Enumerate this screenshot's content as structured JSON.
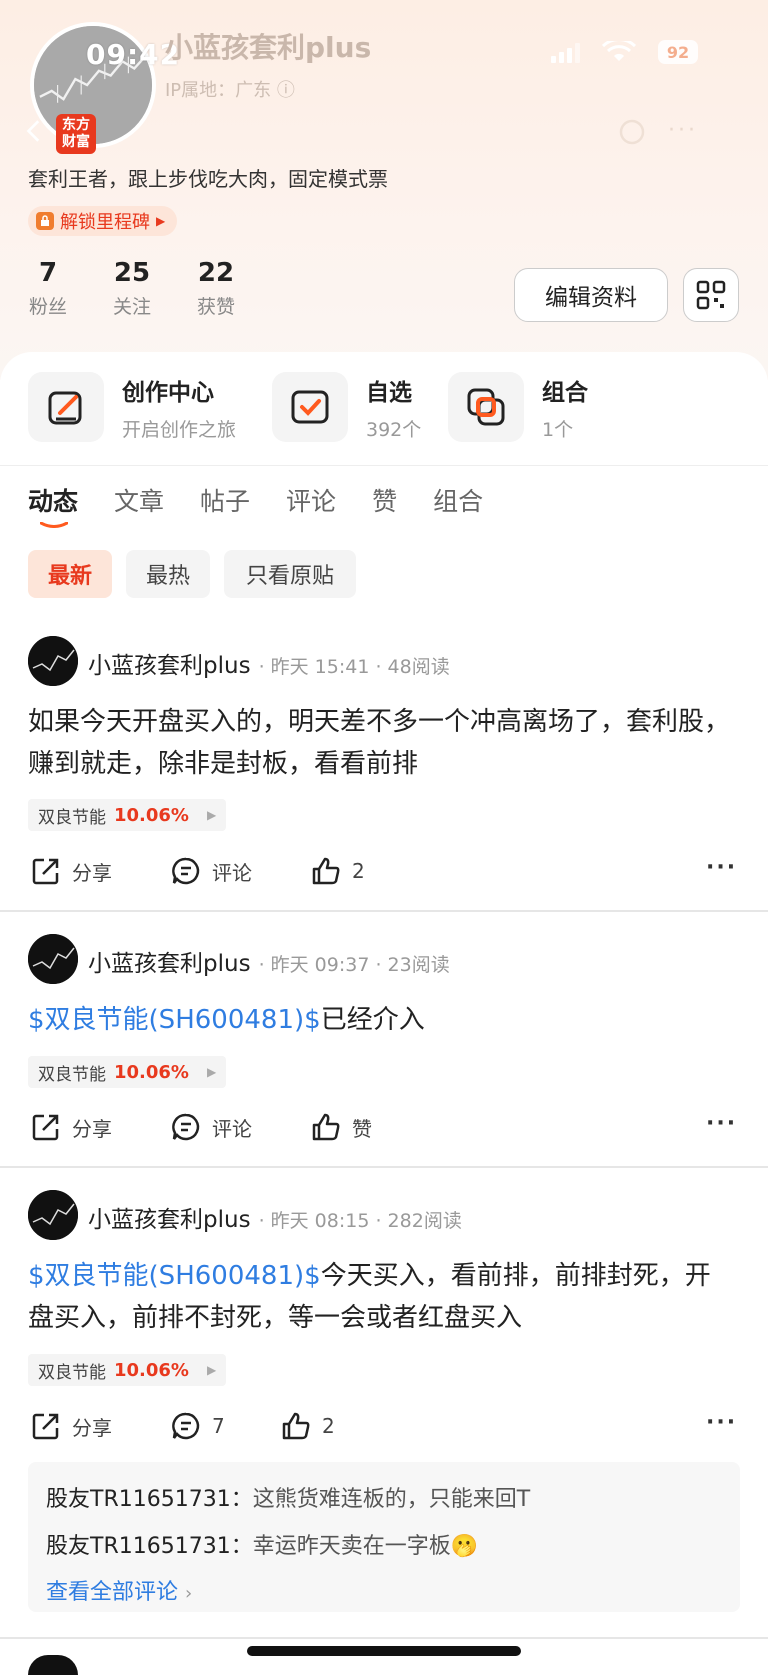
{
  "status_bar": {
    "time": "09:42",
    "battery": "92"
  },
  "profile": {
    "name": "小蓝孩套利plus",
    "ip_label": "IP属地：广东",
    "brand_badge": "东方财富",
    "bio": "套利王者，跟上步伐吃大肉，固定模式票",
    "milestone_label": "解锁里程碑",
    "stats": [
      {
        "value": "7",
        "label": "粉丝"
      },
      {
        "value": "25",
        "label": "关注"
      },
      {
        "value": "22",
        "label": "获赞"
      }
    ],
    "edit_button": "编辑资料"
  },
  "features": [
    {
      "title": "创作中心",
      "subtitle": "开启创作之旅",
      "icon": "pencil-square-icon"
    },
    {
      "title": "自选",
      "subtitle": "392个",
      "icon": "checkbox-icon"
    },
    {
      "title": "组合",
      "subtitle": "1个",
      "icon": "layers-icon"
    }
  ],
  "tabs": [
    "动态",
    "文章",
    "帖子",
    "评论",
    "赞",
    "组合"
  ],
  "active_tab": "动态",
  "filters": [
    "最新",
    "最热",
    "只看原贴"
  ],
  "active_filter": "最新",
  "posts": [
    {
      "author": "小蓝孩套利plus",
      "meta": "· 昨天 15:41 · 48阅读",
      "link_text": "",
      "text": "如果今天开盘买入的，明天差不多一个冲高离场了，套利股，赚到就走，除非是封板，看看前排",
      "stock_name": "双良节能",
      "stock_pct": "10.06%",
      "share": "分享",
      "comment": "评论",
      "like": "2"
    },
    {
      "author": "小蓝孩套利plus",
      "meta": "· 昨天 09:37 · 23阅读",
      "link_text": "$双良节能(SH600481)$",
      "text": "已经介入",
      "stock_name": "双良节能",
      "stock_pct": "10.06%",
      "share": "分享",
      "comment": "评论",
      "like": "赞"
    },
    {
      "author": "小蓝孩套利plus",
      "meta": "· 昨天 08:15 · 282阅读",
      "link_text": "$双良节能(SH600481)$",
      "text": "今天买入，看前排，前排封死，开盘买入，前排不封死，等一会或者红盘买入",
      "stock_name": "双良节能",
      "stock_pct": "10.06%",
      "share": "分享",
      "comment": "7",
      "like": "2",
      "comments": [
        {
          "user": "股友TR11651731：",
          "text": "这熊货难连板的，只能来回T"
        },
        {
          "user": "股友TR11651731：",
          "text": "幸运昨天卖在一字板🫢"
        }
      ],
      "view_all": "查看全部评论"
    }
  ],
  "colors": {
    "accent": "#e8391e",
    "link": "#2f7de1",
    "header_bg": "#fdeee4"
  }
}
